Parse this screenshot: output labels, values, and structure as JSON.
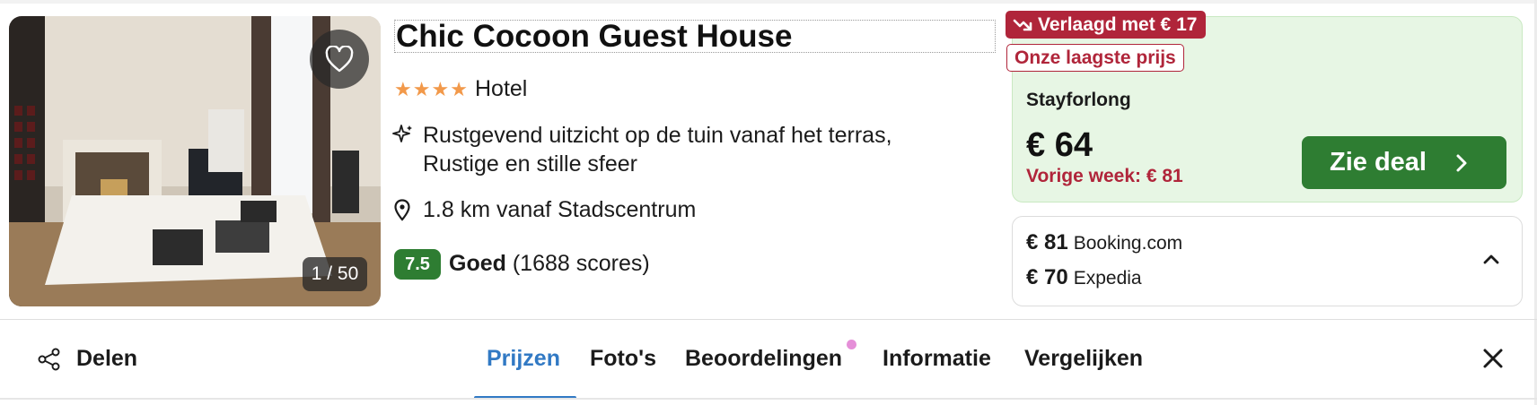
{
  "hotel": {
    "name": "Chic Cocoon Guest House",
    "stars": [
      "★",
      "★",
      "★",
      "★"
    ],
    "type": "Hotel",
    "amenities": "Rustgevend uitzicht op de tuin vanaf het terras, Rustige en stille sfeer",
    "distance": "1.8 km vanaf Stadscentrum",
    "rating": {
      "score": "7.5",
      "label": "Goed",
      "count": "(1688 scores)"
    },
    "photo_counter": "1 / 50"
  },
  "deal": {
    "price_drop_badge": "Verlaagd met € 17",
    "lowest_badge": "Onze laagste prijs",
    "provider": "Stayforlong",
    "price": "€ 64",
    "last_week": "Vorige week: € 81",
    "button_label": "Zie deal"
  },
  "other_offers": [
    {
      "price": "€ 81",
      "provider": "Booking.com"
    },
    {
      "price": "€ 70",
      "provider": "Expedia"
    }
  ],
  "nav": {
    "share_label": "Delen",
    "tabs": [
      {
        "label": "Prijzen",
        "active": true
      },
      {
        "label": "Foto's",
        "active": false
      },
      {
        "label": "Beoordelingen",
        "active": false
      },
      {
        "label": "Informatie",
        "active": false
      },
      {
        "label": "Vergelijken",
        "active": false
      }
    ]
  },
  "icons": {
    "favorite": "heart-icon",
    "amenity": "sparkle-icon",
    "location": "pin-icon",
    "trend": "trend-down-icon",
    "deal": "chevron-right-icon",
    "expand": "chevron-up-icon",
    "share": "share-icon",
    "close": "close-icon"
  },
  "colors": {
    "accent_blue": "#3179c4",
    "deal_green": "#2e7d32",
    "deal_bg": "#e7f6e4",
    "alert_red": "#b0253a",
    "star_orange": "#f2994a"
  }
}
